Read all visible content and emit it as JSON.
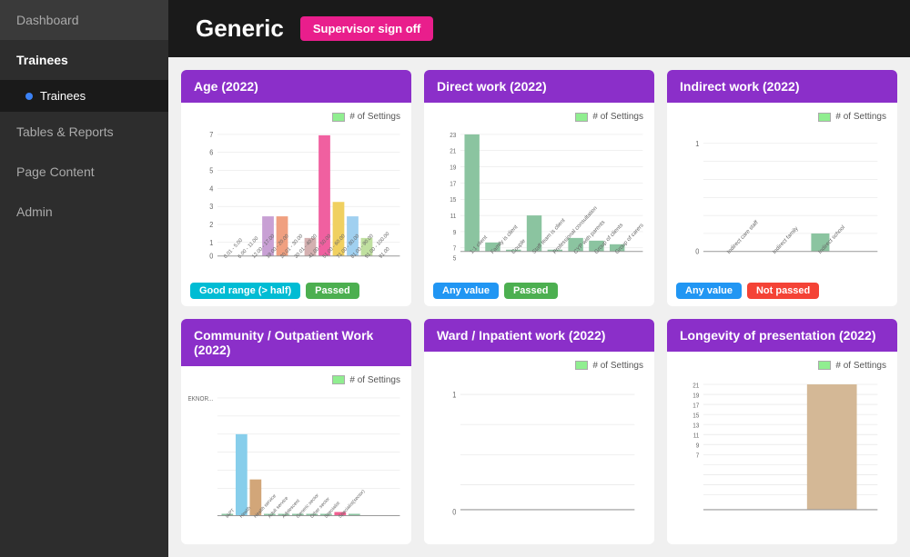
{
  "sidebar": {
    "items": [
      {
        "label": "Dashboard",
        "id": "dashboard",
        "active": false
      },
      {
        "label": "Trainees",
        "id": "trainees",
        "active": true,
        "parent": true
      },
      {
        "label": "Trainees",
        "id": "trainees-sub",
        "sub": true
      },
      {
        "label": "Tables & Reports",
        "id": "tables-reports",
        "active": false
      },
      {
        "label": "Page Content",
        "id": "page-content",
        "active": false
      },
      {
        "label": "Admin",
        "id": "admin",
        "active": false
      }
    ]
  },
  "header": {
    "title": "Generic",
    "supervisor_btn": "Supervisor sign off"
  },
  "cards": [
    {
      "id": "age",
      "title": "Age (2022)",
      "legend": "# of Settings",
      "badges": [
        {
          "label": "Good range (> half)",
          "color": "teal"
        },
        {
          "label": "Passed",
          "color": "green"
        }
      ]
    },
    {
      "id": "direct-work",
      "title": "Direct work (2022)",
      "legend": "# of Settings",
      "badges": [
        {
          "label": "Any value",
          "color": "blue"
        },
        {
          "label": "Passed",
          "color": "green"
        }
      ]
    },
    {
      "id": "indirect-work",
      "title": "Indirect work (2022)",
      "legend": "# of Settings",
      "badges": [
        {
          "label": "Any value",
          "color": "blue"
        },
        {
          "label": "Not passed",
          "color": "red"
        }
      ]
    },
    {
      "id": "community",
      "title": "Community / Outpatient Work (2022)",
      "legend": "# of Settings",
      "badges": []
    },
    {
      "id": "ward",
      "title": "Ward / Inpatient work (2022)",
      "legend": "# of Settings",
      "badges": []
    },
    {
      "id": "longevity",
      "title": "Longevity of presentation (2022)",
      "legend": "# of Settings",
      "badges": []
    }
  ]
}
